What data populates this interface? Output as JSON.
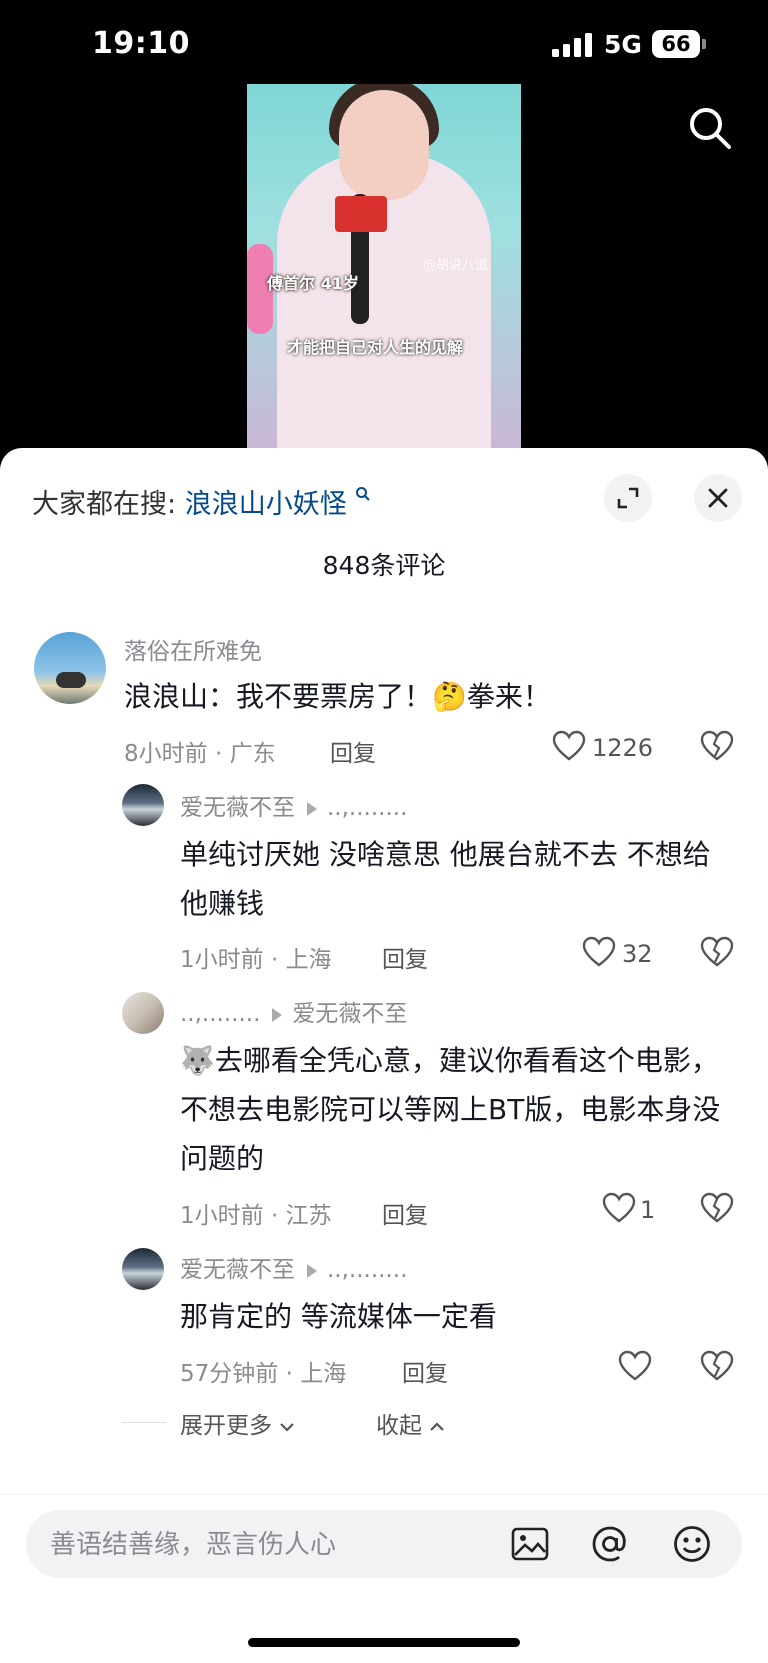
{
  "status": {
    "time": "19:10",
    "network": "5G",
    "battery": "66"
  },
  "video": {
    "caption_name": "傅首尔 41岁",
    "caption_subtitle": "才能把自己对人生的见解",
    "watermark": "@胡说八道"
  },
  "header": {
    "trend_prefix": "大家都在搜:",
    "trend_keyword": "浪浪山小妖怪",
    "comment_count": "848条评论"
  },
  "comments": [
    {
      "user": "落俗在所难免",
      "text": "浪浪山：我不要票房了！🤔拳来！",
      "meta": "8小时前 · 广东",
      "reply": "回复",
      "likes": "1226"
    },
    {
      "user": "爱无薇不至",
      "reply_to": "..,........",
      "text": "单纯讨厌她  没啥意思  他展台就不去  不想给他赚钱",
      "meta": "1小时前 · 上海",
      "reply": "回复",
      "likes": "32"
    },
    {
      "user": "..,........",
      "reply_to": "爱无薇不至",
      "text": "🐺去哪看全凭心意，建议你看看这个电影，不想去电影院可以等网上BT版，电影本身没问题的",
      "meta": "1小时前 · 江苏",
      "reply": "回复",
      "likes": "1"
    },
    {
      "user": "爱无薇不至",
      "reply_to": "..,........",
      "text": "那肯定的   等流媒体一定看",
      "meta": "57分钟前 · 上海",
      "reply": "回复",
      "likes": ""
    }
  ],
  "thread": {
    "expand_more": "展开更多",
    "collapse": "收起"
  },
  "input": {
    "placeholder": "善语结善缘，恶言伤人心"
  }
}
